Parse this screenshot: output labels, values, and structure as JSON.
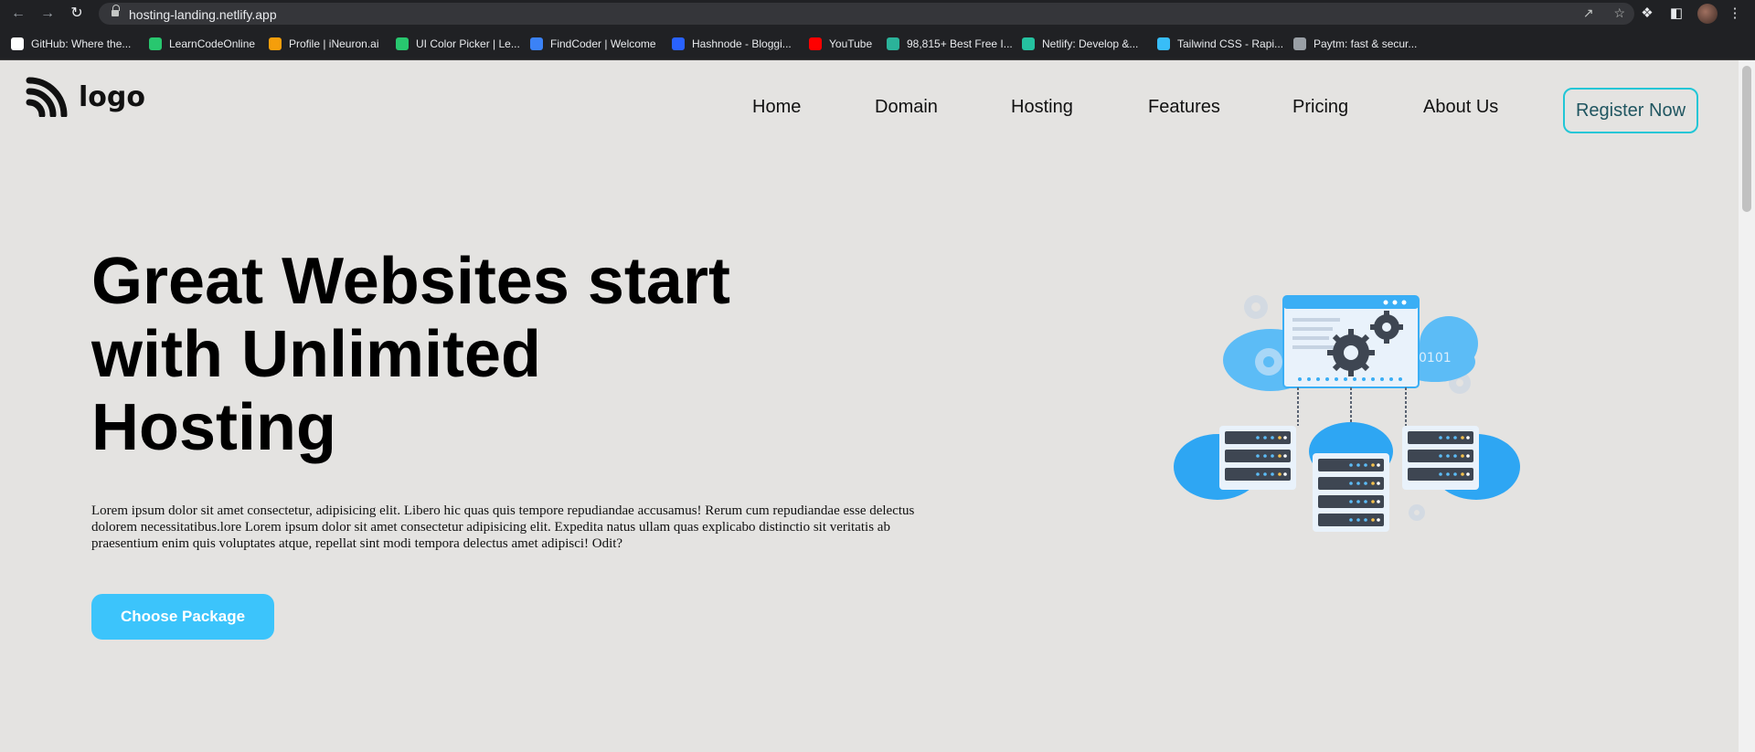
{
  "browser": {
    "url": "hosting-landing.netlify.app",
    "bookmarks": [
      {
        "label": "GitHub: Where the...",
        "icon": "github-icon",
        "color": "#ffffff"
      },
      {
        "label": "LearnCodeOnline",
        "icon": "learncodeonline-icon",
        "color": "#28c76f"
      },
      {
        "label": "Profile | iNeuron.ai",
        "icon": "ineuron-icon",
        "color": "#f59e0b"
      },
      {
        "label": "UI Color Picker | Le...",
        "icon": "colorpicker-icon",
        "color": "#28c76f"
      },
      {
        "label": "FindCoder | Welcome",
        "icon": "findcoder-icon",
        "color": "#3b82f6"
      },
      {
        "label": "Hashnode - Bloggi...",
        "icon": "hashnode-icon",
        "color": "#2962ff"
      },
      {
        "label": "YouTube",
        "icon": "youtube-icon",
        "color": "#ff0000"
      },
      {
        "label": "98,815+ Best Free I...",
        "icon": "freeimages-icon",
        "color": "#2bb39a"
      },
      {
        "label": "Netlify: Develop &...",
        "icon": "netlify-icon",
        "color": "#25c2a0"
      },
      {
        "label": "Tailwind CSS - Rapi...",
        "icon": "tailwind-icon",
        "color": "#38bdf8"
      },
      {
        "label": "Paytm: fast & secur...",
        "icon": "paytm-icon",
        "color": "#9aa0a6"
      }
    ]
  },
  "header": {
    "logo_text": "logo",
    "nav": [
      "Home",
      "Domain",
      "Hosting",
      "Features",
      "Pricing",
      "About Us"
    ],
    "register_label": "Register Now"
  },
  "hero": {
    "title_lines": [
      "Great Websites start",
      "with Unlimited",
      "Hosting"
    ],
    "description": "Lorem ipsum dolor sit amet consectetur, adipisicing elit. Libero hic quas quis tempore repudiandae accusamus! Rerum cum repudiandae esse delectus dolorem necessitatibus.lore Lorem ipsum dolor sit amet consectetur adipisicing elit. Expedita natus ullam quas explicabo distinctio sit veritatis ab praesentium enim quis voluptates atque, repellat sint modi tempora delectus amet adipisci! Odit?",
    "cta_label": "Choose Package",
    "illustration_text": "0101"
  },
  "colors": {
    "page_bg": "#e4e3e1",
    "accent": "#3cc4fb",
    "register_border": "#21c6d6"
  }
}
